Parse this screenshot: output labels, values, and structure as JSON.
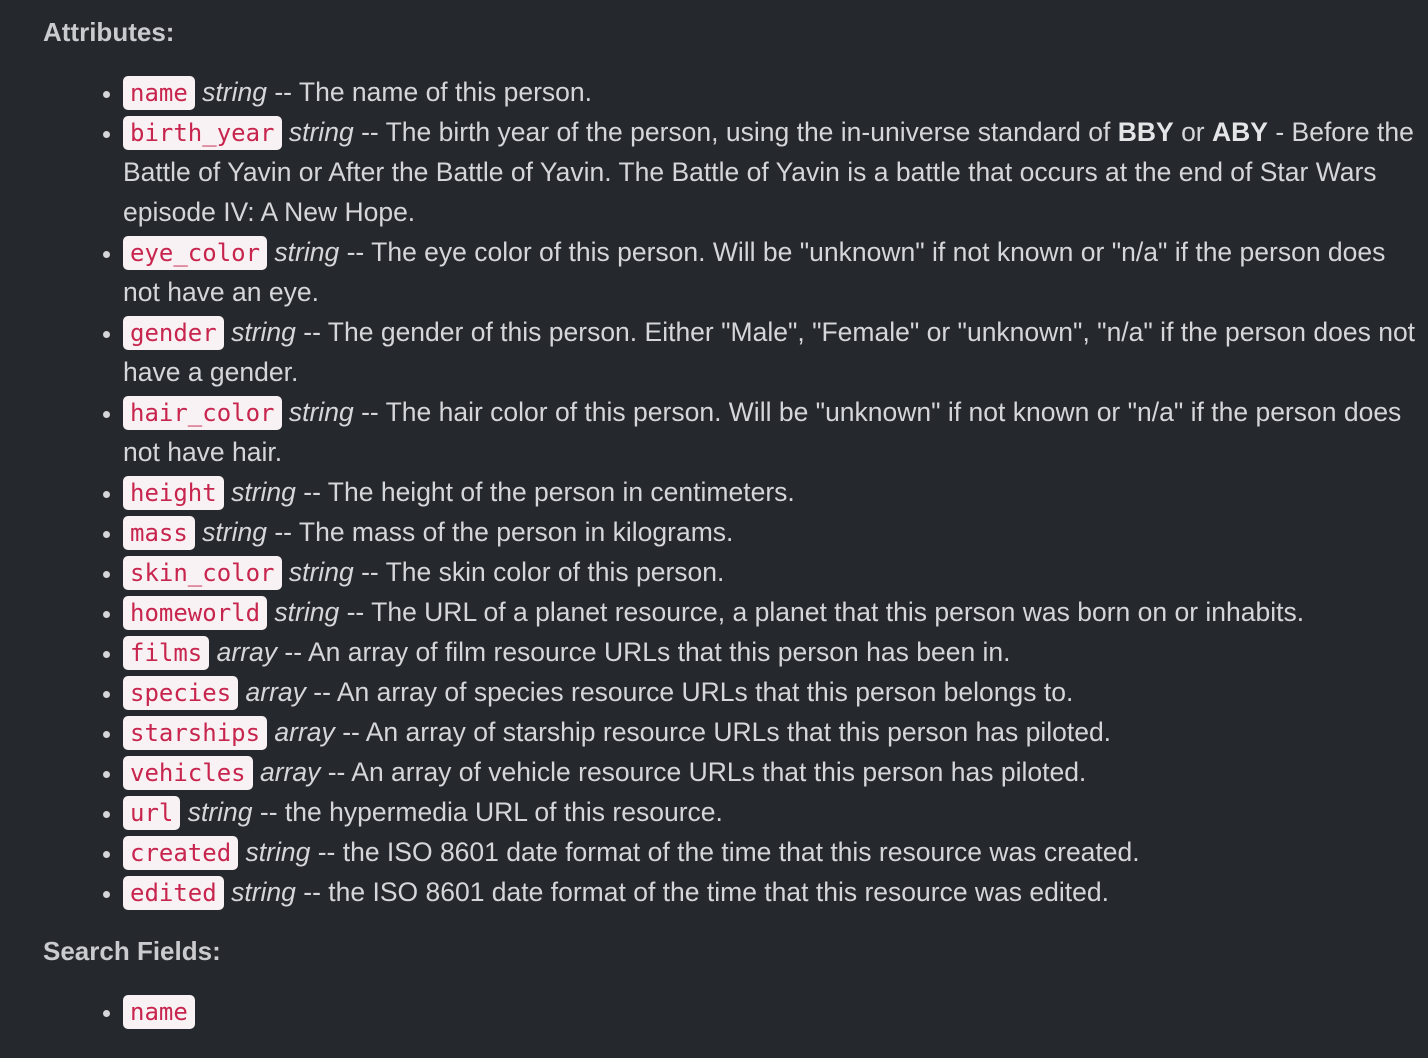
{
  "attributes_heading": "Attributes:",
  "attributes": [
    {
      "name": "name",
      "type": "string",
      "desc": "-- The name of this person."
    },
    {
      "name": "birth_year",
      "type": "string",
      "desc_pre": "-- The birth year of the person, using the in-universe standard of",
      "bold1": "BBY",
      "mid": "or",
      "bold2": "ABY",
      "desc_post": "- Before the Battle of Yavin or After the Battle of Yavin. The Battle of Yavin is a battle that occurs at the end of Star Wars episode IV: A New Hope."
    },
    {
      "name": "eye_color",
      "type": "string",
      "desc": "-- The eye color of this person. Will be \"unknown\" if not known or \"n/a\" if the person does not have an eye."
    },
    {
      "name": "gender",
      "type": "string",
      "desc": "-- The gender of this person. Either \"Male\", \"Female\" or \"unknown\", \"n/a\" if the person does not have a gender."
    },
    {
      "name": "hair_color",
      "type": "string",
      "desc": "-- The hair color of this person. Will be \"unknown\" if not known or \"n/a\" if the person does not have hair."
    },
    {
      "name": "height",
      "type": "string",
      "desc": "-- The height of the person in centimeters."
    },
    {
      "name": "mass",
      "type": "string",
      "desc": "-- The mass of the person in kilograms."
    },
    {
      "name": "skin_color",
      "type": "string",
      "desc": "-- The skin color of this person."
    },
    {
      "name": "homeworld",
      "type": "string",
      "desc": "-- The URL of a planet resource, a planet that this person was born on or inhabits."
    },
    {
      "name": "films",
      "type": "array",
      "desc": "-- An array of film resource URLs that this person has been in."
    },
    {
      "name": "species",
      "type": "array",
      "desc": "-- An array of species resource URLs that this person belongs to."
    },
    {
      "name": "starships",
      "type": "array",
      "desc": "-- An array of starship resource URLs that this person has piloted."
    },
    {
      "name": "vehicles",
      "type": "array",
      "desc": "-- An array of vehicle resource URLs that this person has piloted."
    },
    {
      "name": "url",
      "type": "string",
      "desc": "-- the hypermedia URL of this resource."
    },
    {
      "name": "created",
      "type": "string",
      "desc": "-- the ISO 8601 date format of the time that this resource was created."
    },
    {
      "name": "edited",
      "type": "string",
      "desc": "-- the ISO 8601 date format of the time that this resource was edited."
    }
  ],
  "search_heading": "Search Fields:",
  "search_fields": [
    {
      "name": "name"
    }
  ],
  "colors": {
    "background": "#25282c",
    "text": "#d4d6d9",
    "code_text": "#c7254e",
    "code_background": "#f9f2f4"
  }
}
